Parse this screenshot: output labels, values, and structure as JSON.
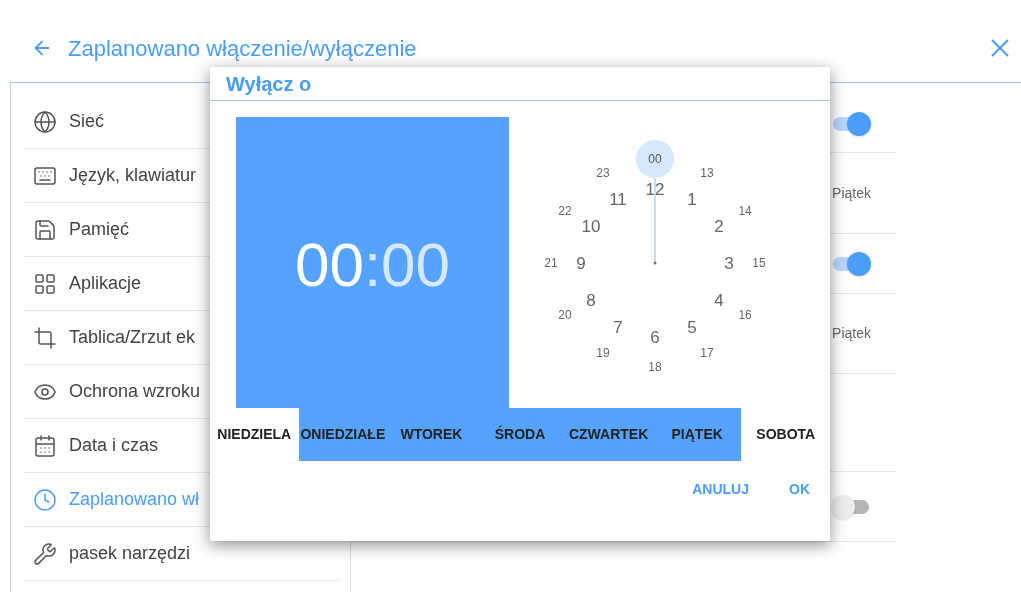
{
  "header": {
    "title": "Zaplanowano włączenie/wyłączenie"
  },
  "sidebar": {
    "items": [
      {
        "label": "Sieć",
        "selected": false
      },
      {
        "label": "Język, klawiatur",
        "selected": false
      },
      {
        "label": "Pamięć",
        "selected": false
      },
      {
        "label": "Aplikacje",
        "selected": false
      },
      {
        "label": "Tablica/Zrzut ek",
        "selected": false
      },
      {
        "label": "Ochrona wzroku",
        "selected": false
      },
      {
        "label": "Data i czas",
        "selected": false
      },
      {
        "label": "Zaplanowano wł",
        "selected": true
      },
      {
        "label": "pasek narzędzi",
        "selected": false
      }
    ]
  },
  "content": {
    "rows": [
      {
        "kind": "toggle",
        "on": true
      },
      {
        "kind": "text",
        "text": "Piątek"
      },
      {
        "kind": "toggle",
        "on": true
      },
      {
        "kind": "text",
        "text": "Piątek"
      },
      {
        "kind": "empty"
      },
      {
        "kind": "toggle",
        "on": false
      }
    ]
  },
  "dialog": {
    "title": "Wyłącz o",
    "time": {
      "hours": "00",
      "separator": ":",
      "minutes": "00",
      "hours_selected": true
    },
    "clock": {
      "inner": [
        {
          "label": "12",
          "selected": false
        },
        {
          "label": "1",
          "selected": false
        },
        {
          "label": "2",
          "selected": false
        },
        {
          "label": "3",
          "selected": false
        },
        {
          "label": "4",
          "selected": false
        },
        {
          "label": "5",
          "selected": false
        },
        {
          "label": "6",
          "selected": false
        },
        {
          "label": "7",
          "selected": false
        },
        {
          "label": "8",
          "selected": false
        },
        {
          "label": "9",
          "selected": false
        },
        {
          "label": "10",
          "selected": false
        },
        {
          "label": "11",
          "selected": false
        }
      ],
      "outer": [
        {
          "label": "00",
          "selected": true
        },
        {
          "label": "13",
          "selected": false
        },
        {
          "label": "14",
          "selected": false
        },
        {
          "label": "15",
          "selected": false
        },
        {
          "label": "16",
          "selected": false
        },
        {
          "label": "17",
          "selected": false
        },
        {
          "label": "18",
          "selected": false
        },
        {
          "label": "19",
          "selected": false
        },
        {
          "label": "20",
          "selected": false
        },
        {
          "label": "21",
          "selected": false
        },
        {
          "label": "22",
          "selected": false
        },
        {
          "label": "23",
          "selected": false
        }
      ]
    },
    "days": [
      {
        "label": "NIEDZIELA",
        "selected": false
      },
      {
        "label": "ONIEDZIAŁE",
        "selected": true
      },
      {
        "label": "WTOREK",
        "selected": true
      },
      {
        "label": "ŚRODA",
        "selected": true
      },
      {
        "label": "CZWARTEK",
        "selected": true
      },
      {
        "label": "PIĄTEK",
        "selected": true
      },
      {
        "label": "SOBOTA",
        "selected": false
      }
    ],
    "buttons": [
      "ANULUJ",
      "OK"
    ]
  }
}
